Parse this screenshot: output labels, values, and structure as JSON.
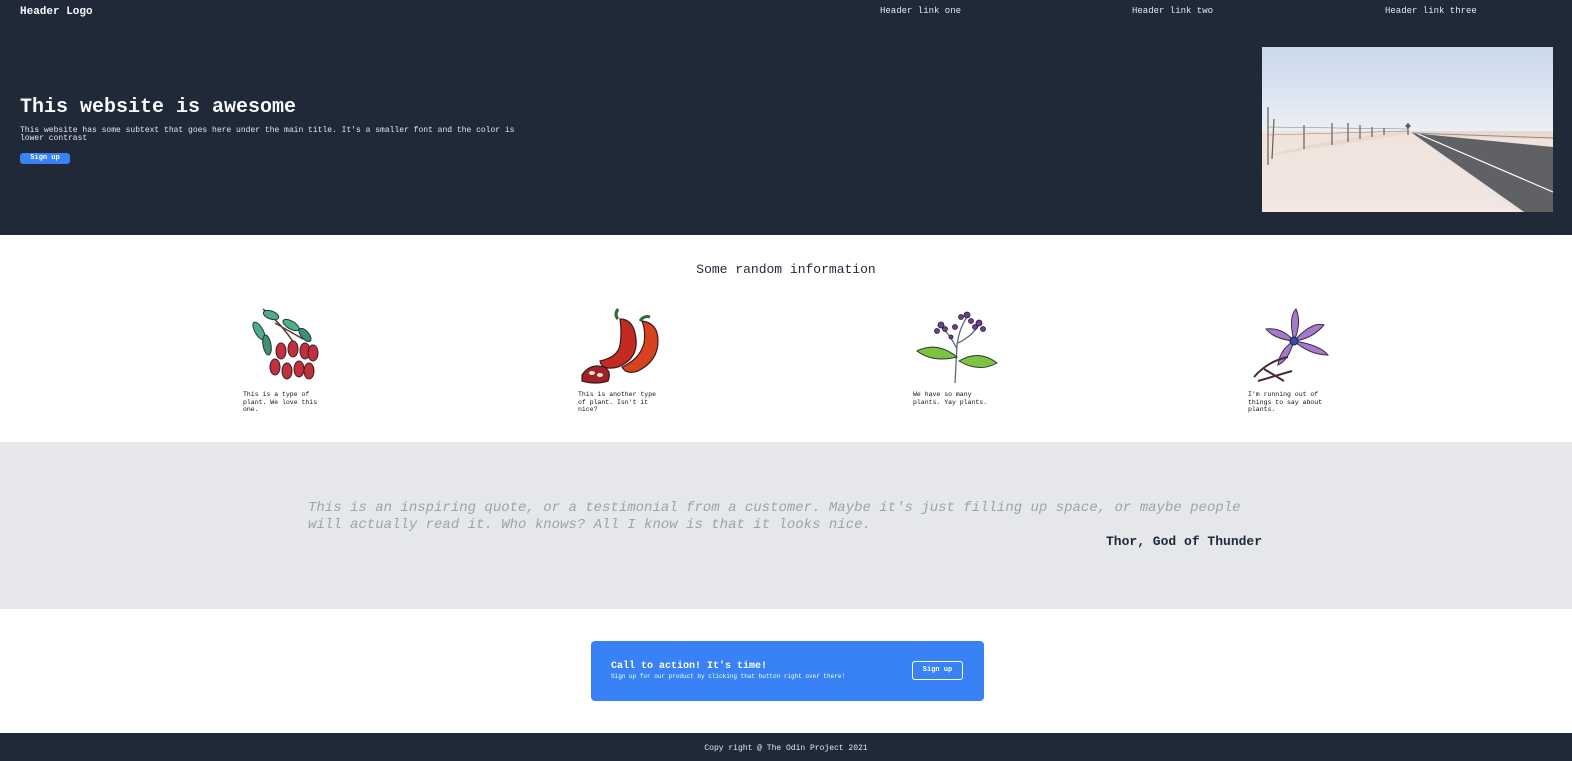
{
  "header": {
    "logo": "Header Logo",
    "links": [
      "Header link one",
      "Header link two",
      "Header link three"
    ]
  },
  "hero": {
    "title": "This website is awesome",
    "subtitle": "This website has some subtext that goes here under the main title. It's a smaller font and the color is lower contrast",
    "button_label": "Sign up"
  },
  "info": {
    "title": "Some random information",
    "cards": [
      {
        "text": "This is a type of plant. We love this one.",
        "icon": "berries-plant-icon"
      },
      {
        "text": "This is another type of plant. Isn't it nice?",
        "icon": "chili-pepper-icon"
      },
      {
        "text": "We have so many plants. Yay plants.",
        "icon": "flowering-sprig-icon"
      },
      {
        "text": "I'm running out of things to say about plants.",
        "icon": "purple-flower-icon"
      }
    ]
  },
  "quote": {
    "text": "This is an inspiring quote, or a testimonial from a customer. Maybe it's just filling up space, or maybe people will actually read it. Who knows? All I know is that it looks nice.",
    "author": "Thor, God of Thunder"
  },
  "cta": {
    "title": "Call to action! It's time!",
    "subtitle": "Sign up for our product by clicking that button right over there!",
    "button_label": "Sign up"
  },
  "footer": {
    "text": "Copy right @ The Odin Project 2021"
  },
  "colors": {
    "dark": "#1f2937",
    "accent": "#3882f6",
    "band": "#e5e7eb"
  }
}
